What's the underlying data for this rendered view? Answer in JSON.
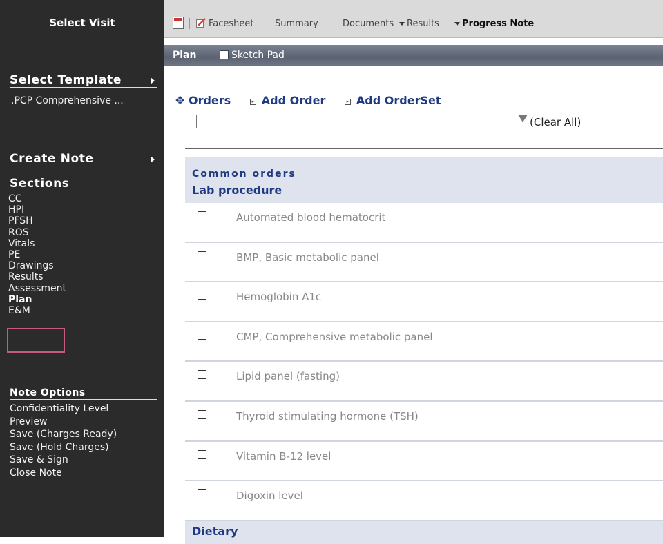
{
  "sidebar": {
    "title": "Select Visit",
    "select_template": "Select Template",
    "template_value": ".PCP Comprehensive ...",
    "create_note": "Create Note",
    "sections_label": "Sections",
    "sections": [
      "CC",
      "HPI",
      "PFSH",
      "ROS",
      "Vitals",
      "PE",
      "Drawings",
      "Results",
      "Assessment",
      "Plan",
      "E&M"
    ],
    "note_options_label": "Note Options",
    "options": [
      "Confidentiality Level",
      "Preview",
      "Save (Charges Ready)",
      "Save (Hold Charges)",
      "Save & Sign",
      "Close Note"
    ]
  },
  "tabs": {
    "facesheet": "Facesheet",
    "summary": "Summary",
    "documents": "Documents",
    "results": "Results",
    "progress_note": "Progress Note"
  },
  "plan_bar": {
    "label": "Plan",
    "sketch_pad": "Sketch Pad"
  },
  "orders": {
    "label": "Orders",
    "add_order": "Add Order",
    "add_orderset": "Add OrderSet",
    "search_value": "",
    "clear_all": "(Clear All)"
  },
  "common_orders": {
    "heading": "Common orders",
    "category": "Lab procedure",
    "items": [
      "Automated blood hematocrit",
      "BMP, Basic metabolic panel",
      "Hemoglobin A1c",
      "CMP, Comprehensive metabolic panel",
      "Lipid panel (fasting)",
      "Thyroid stimulating hormone (TSH)",
      "Vitamin B-12 level",
      "Digoxin level"
    ],
    "next_category": "Dietary"
  },
  "colors": {
    "sidebar": "#2b2b2b",
    "highlight": "#c65a80",
    "link": "#1f3a80"
  }
}
